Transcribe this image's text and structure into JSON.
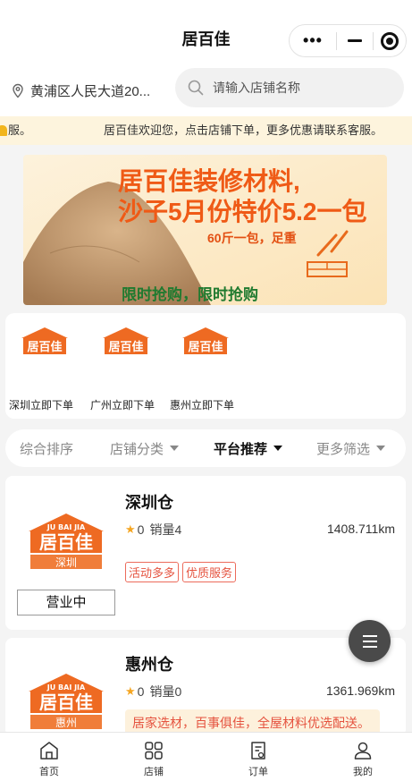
{
  "header": {
    "title": "居百佳"
  },
  "capsule": {
    "more": "•••"
  },
  "location": {
    "text": "黄浦区人民大道20..."
  },
  "search": {
    "placeholder": "请输入店铺名称"
  },
  "notice": {
    "tail": "服。",
    "text": "居百佳欢迎您，点击店铺下单，更多优惠请联系客服。"
  },
  "banner": {
    "line1": "居百佳装修材料,",
    "line2": "沙子5月份特价5.2一包",
    "line3": "60斤一包，足重",
    "line4": "限时抢购，限时抢购"
  },
  "logo": {
    "pinyin": "JU BAI JIA",
    "brand": "居百佳"
  },
  "categories": [
    {
      "label": "深圳立即下单"
    },
    {
      "label": "广州立即下单"
    },
    {
      "label": "惠州立即下单"
    }
  ],
  "filters": [
    {
      "label": "综合排序"
    },
    {
      "label": "店铺分类"
    },
    {
      "label": "平台推荐"
    },
    {
      "label": "更多筛选"
    }
  ],
  "stores": [
    {
      "name": "深圳仓",
      "city": "深圳",
      "rating": "0",
      "sales": "销量4",
      "distance": "1408.711km",
      "tags": [
        "活动多多",
        "优质服务"
      ],
      "status": "营业中"
    },
    {
      "name": "惠州仓",
      "city": "惠州",
      "rating": "0",
      "sales": "销量0",
      "distance": "1361.969km",
      "promo": "居家选材，百事俱佳，全屋材料优选配送。"
    }
  ],
  "tabs": [
    {
      "label": "首页"
    },
    {
      "label": "店铺"
    },
    {
      "label": "订单"
    },
    {
      "label": "我的"
    }
  ],
  "colors": {
    "brand_orange": "#ee6a22",
    "tag_red": "#e5533f",
    "notice_bg": "#fdf4dd"
  }
}
